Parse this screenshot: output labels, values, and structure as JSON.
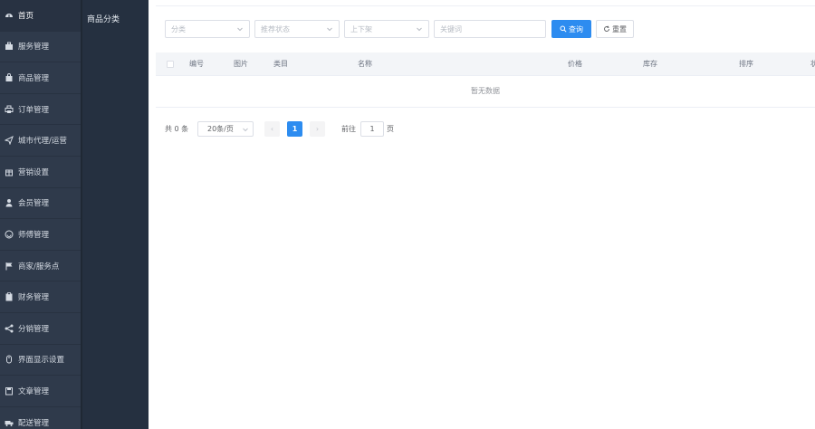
{
  "sidebar": {
    "items": [
      {
        "label": "首页",
        "icon": "dashboard-icon",
        "active": true
      },
      {
        "label": "服务管理",
        "icon": "briefcase-icon"
      },
      {
        "label": "商品管理",
        "icon": "bag-icon"
      },
      {
        "label": "订单管理",
        "icon": "printer-icon"
      },
      {
        "label": "城市代理/运营",
        "icon": "send-icon"
      },
      {
        "label": "营销设置",
        "icon": "gift-icon"
      },
      {
        "label": "会员管理",
        "icon": "user-icon"
      },
      {
        "label": "师傅管理",
        "icon": "smile-icon"
      },
      {
        "label": "商家/服务点",
        "icon": "flag-icon"
      },
      {
        "label": "财务管理",
        "icon": "clipboard-icon"
      },
      {
        "label": "分销管理",
        "icon": "share-icon"
      },
      {
        "label": "界面显示设置",
        "icon": "mouse-icon"
      },
      {
        "label": "文章管理",
        "icon": "save-icon"
      },
      {
        "label": "配送管理",
        "icon": "truck-icon"
      }
    ]
  },
  "subnav": {
    "items": [
      {
        "label": "商品分类"
      }
    ]
  },
  "filters": {
    "category_placeholder": "分类",
    "recommend_placeholder": "推荐状态",
    "shelf_placeholder": "上下架",
    "keyword_placeholder": "关键词",
    "search_label": "查询",
    "reset_label": "重置"
  },
  "table": {
    "columns": [
      "编号",
      "图片",
      "类目",
      "名称",
      "价格",
      "库存",
      "排序",
      "状"
    ],
    "empty_text": "暂无数据"
  },
  "pagination": {
    "total_label": "共 0 条",
    "page_size": "20条/页",
    "prev": "‹",
    "current": "1",
    "next": "›",
    "goto_label": "前往",
    "goto_value": "1",
    "page_suffix": "页"
  },
  "colors": {
    "sidebar_bg": "#2f3a4b",
    "subnav_bg": "#253040",
    "accent": "#2d8cf0"
  }
}
